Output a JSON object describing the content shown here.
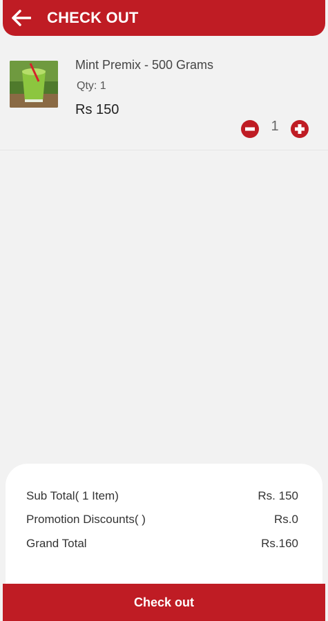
{
  "header": {
    "title": "CHECK OUT",
    "back_icon": "arrow-left-icon"
  },
  "cart": {
    "items": [
      {
        "name": "Mint Premix - 500 Grams",
        "qty_label": "Qty: 1",
        "price": "Rs 150",
        "quantity": "1",
        "image": "green-drink-glass-thumbnail"
      }
    ]
  },
  "summary": {
    "subtotal_label": "Sub Total( 1 Item)",
    "subtotal_value": "Rs. 150",
    "discount_label": "Promotion Discounts( )",
    "discount_value": "Rs.0",
    "grand_total_label": "Grand Total",
    "grand_total_value": "Rs.160"
  },
  "footer": {
    "checkout_label": "Check out"
  },
  "colors": {
    "accent": "#bf1c24",
    "background": "#f2f2f2"
  }
}
